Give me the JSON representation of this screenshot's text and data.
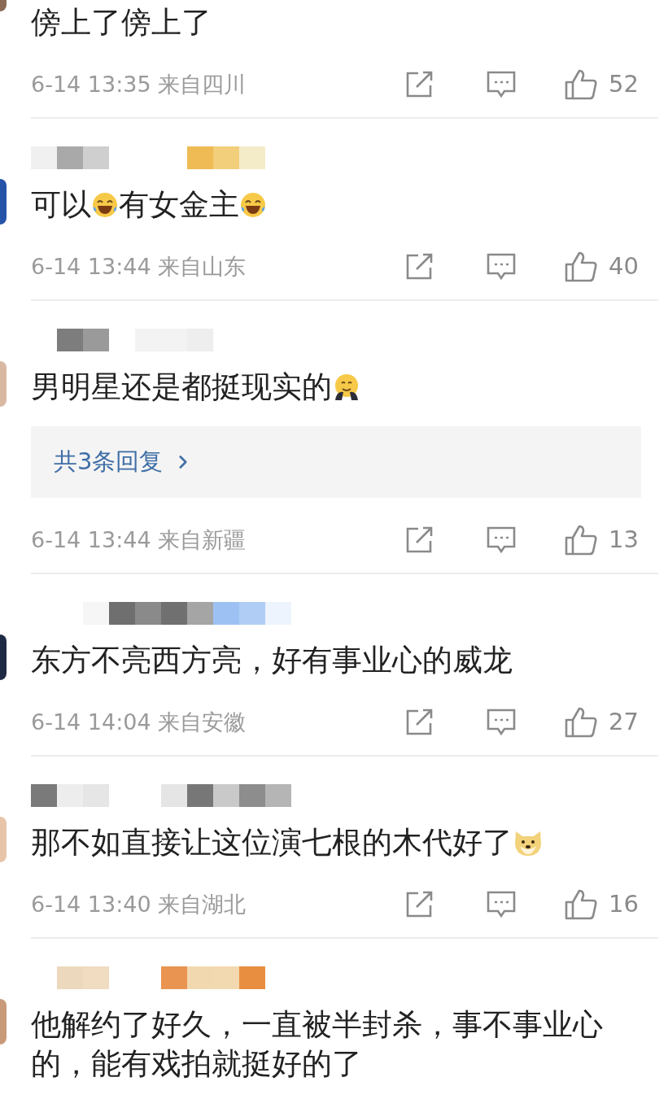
{
  "comments": [
    {
      "content": [
        {
          "kind": "text",
          "text": "傍上了傍上了"
        }
      ],
      "time": "6-14 13:35 来自四川",
      "likes": "52"
    },
    {
      "content": [
        {
          "kind": "text",
          "text": "可以"
        },
        {
          "kind": "laugh_emoji"
        },
        {
          "kind": "text",
          "text": "有女金主"
        },
        {
          "kind": "laugh_emoji"
        }
      ],
      "time": "6-14 13:44 来自山东",
      "likes": "40"
    },
    {
      "content": [
        {
          "kind": "text",
          "text": "男明星还是都挺现实的"
        },
        {
          "kind": "hug_emoji"
        }
      ],
      "replies": "共3条回复",
      "time": "6-14 13:44 来自新疆",
      "likes": "13"
    },
    {
      "content": [
        {
          "kind": "text",
          "text": "东方不亮西方亮，好有事业心的威龙"
        }
      ],
      "time": "6-14 14:04 来自安徽",
      "likes": "27"
    },
    {
      "content": [
        {
          "kind": "text",
          "text": "那不如直接让这位演七根的木代好了"
        },
        {
          "kind": "doge_emoji"
        }
      ],
      "time": "6-14 13:40 来自湖北",
      "likes": "16"
    },
    {
      "content": [
        {
          "kind": "text",
          "text": "他解约了好久，一直被半封杀，事不事业心的，能有戏拍就挺好的了"
        }
      ]
    }
  ]
}
